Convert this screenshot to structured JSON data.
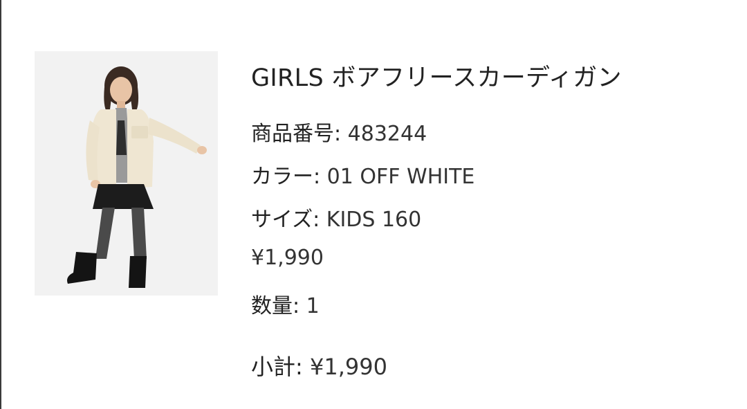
{
  "product": {
    "title": "GIRLS ボアフリースカーディガン",
    "sku_label": "商品番号",
    "sku_value": "483244",
    "color_label": "カラー",
    "color_value": "01 OFF WHITE",
    "size_label": "サイズ",
    "size_value": "KIDS 160",
    "price": "¥1,990",
    "qty_label": "数量",
    "qty_value": "1",
    "separator": ": "
  },
  "summary": {
    "subtotal_label": "小計",
    "subtotal_value": "¥1,990"
  }
}
